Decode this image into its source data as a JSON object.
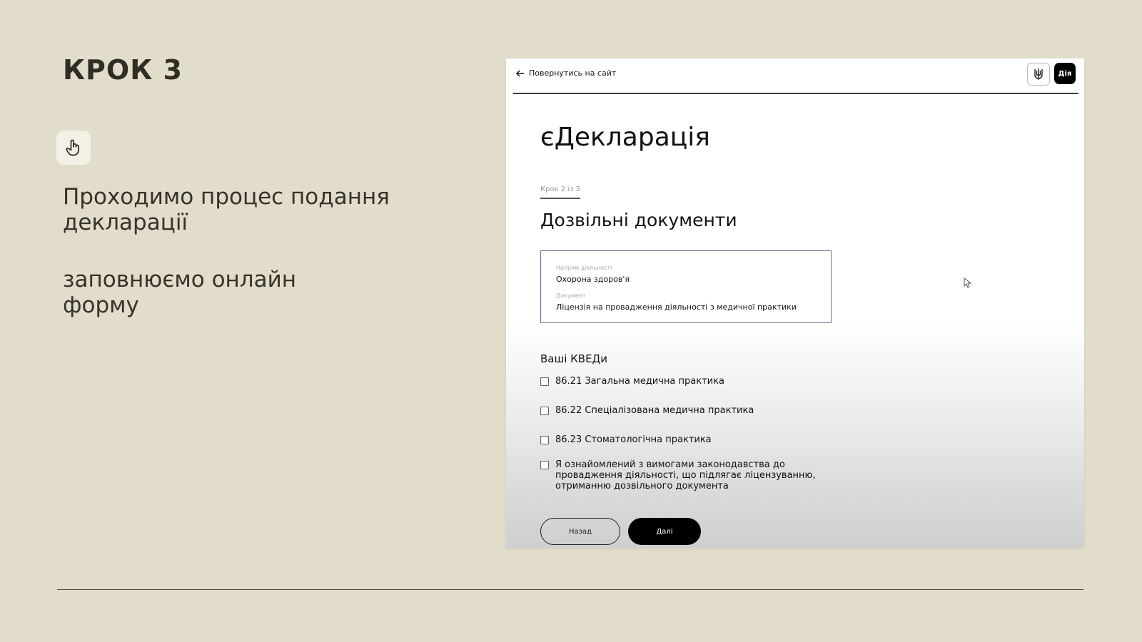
{
  "slide": {
    "title": "КРОК 3",
    "icon": "hand-pointer-icon",
    "description_1": "Проходимо процес подання\nдекларації",
    "description_2": "заповнюємо онлайн\nформу"
  },
  "app": {
    "back_link": "Повернутись на сайт",
    "logo_label": "Дія",
    "title": "єДекларація",
    "step_indicator": "Крок 2 із 3",
    "section_title": "Дозвільні документи",
    "document_card": {
      "activity_label": "Напрям діяльності",
      "activity_value": "Охорона здоров'я",
      "document_label": "Документ",
      "document_value": "Ліцензія на провадження діяльності з медичної практики"
    },
    "kved_title": "Ваші КВЕДи",
    "kveds": [
      {
        "label": "86.21 Загальна медична практика",
        "checked": false
      },
      {
        "label": "86.22 Спеціалізована медична практика",
        "checked": false
      },
      {
        "label": "86.23 Стоматологічна практика",
        "checked": false
      }
    ],
    "acknowledgement": {
      "label": "Я ознайомлений з вимогами законодавства до\nпровадження діяльності, що підлягає ліцензуванню,\nотриманню дозвільного документа",
      "checked": false
    },
    "back_button": "Назад",
    "next_button": "Далі"
  },
  "colors": {
    "background": "#e2ddcb",
    "text": "#2c2a22",
    "primary_button": "#000000",
    "card_border": "#7a6a9a"
  }
}
